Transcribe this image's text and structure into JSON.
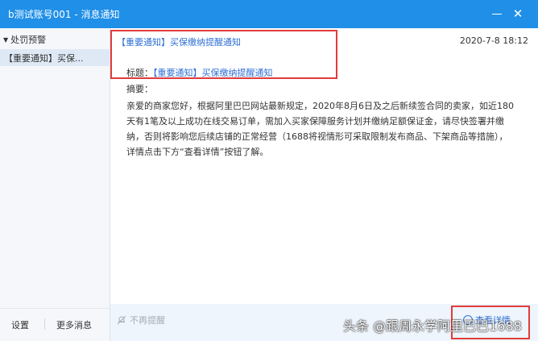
{
  "window": {
    "title": "b测试账号001 - 消息通知"
  },
  "sidebar": {
    "group_label": "处罚预警",
    "items": [
      {
        "label": "【重要通知】买保..."
      }
    ],
    "footer": {
      "settings_label": "设置",
      "more_label": "更多消息"
    }
  },
  "message": {
    "subject": "【重要通知】买保缴纳提醒通知",
    "date": "2020-7-8 18:12",
    "title_prefix": "标题：",
    "title_link": "【重要通知】买保缴纳提醒通知",
    "summary_label": "摘要：",
    "body": "亲爱的商家您好，根据阿里巴巴网站最新规定，2020年8月6日及之后新续签合同的卖家，如近180天有1笔及以上成功在线交易订单，需加入买家保障服务计划并缴纳足额保证金，请尽快签署并缴纳，否则将影响您后续店铺的正常经营（1688将视情形可采取限制发布商品、下架商品等措施），详情点击下方“查看详情”按钮了解。"
  },
  "bottom_bar": {
    "no_remind_label": "不再提醒",
    "view_detail_label": "查看详情"
  },
  "watermark": "头条 @跟周永学阿里巴巴1688",
  "colors": {
    "titlebar": "#1f8fe8",
    "link": "#2f6fd6",
    "highlight": "#e23b3b"
  }
}
